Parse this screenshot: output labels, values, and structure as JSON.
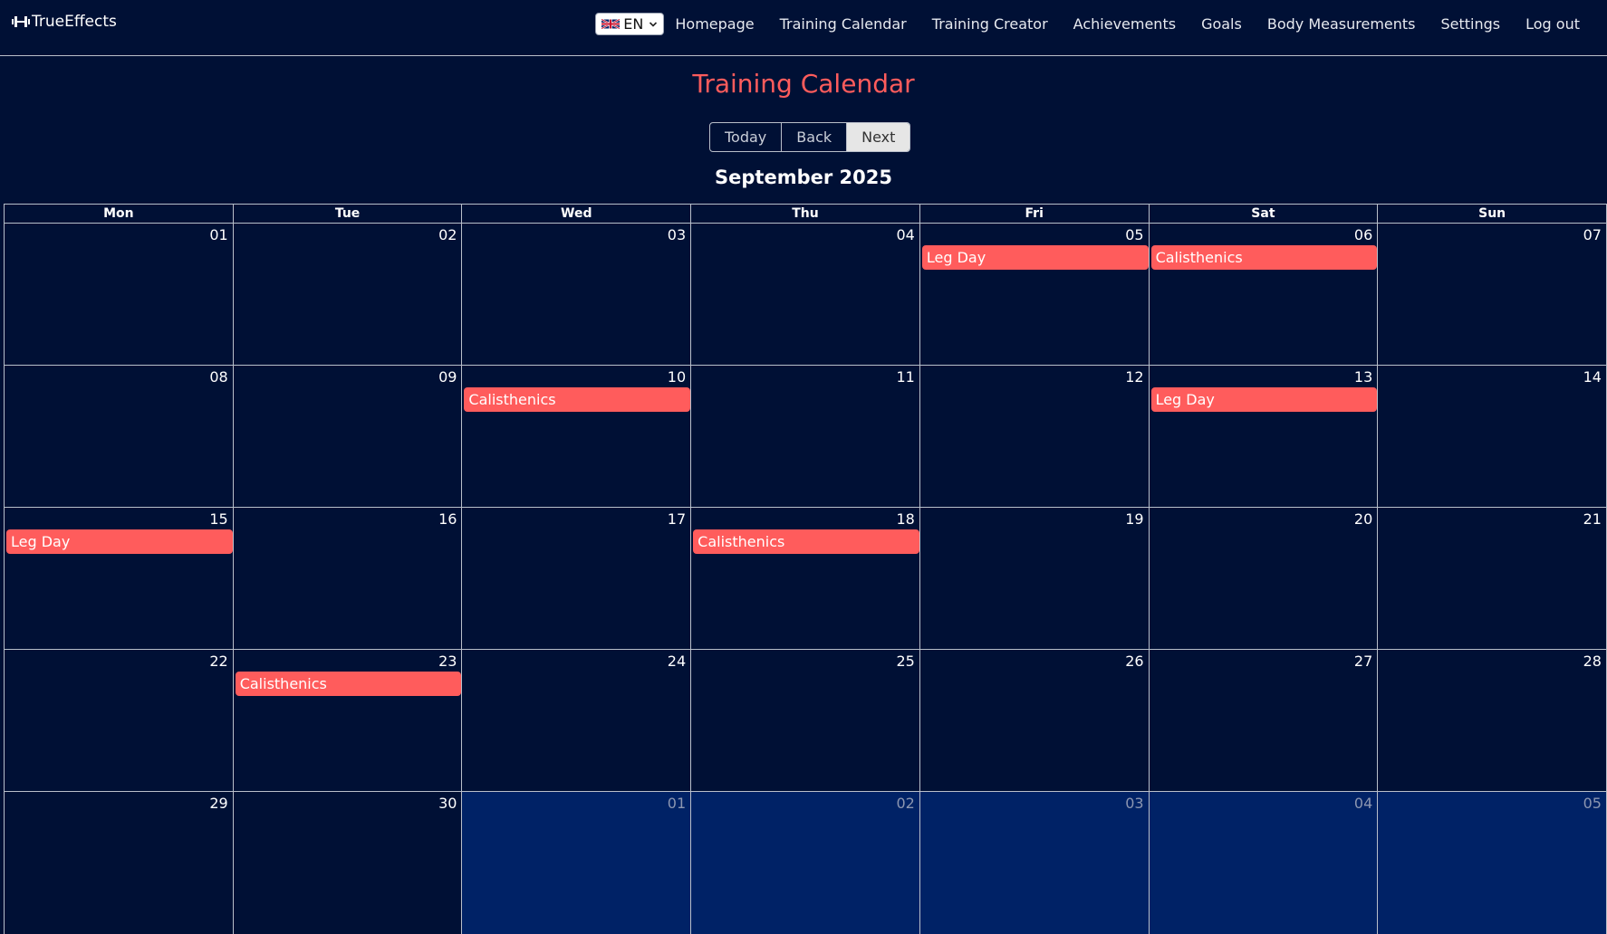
{
  "nav": {
    "brand": "TrueEffects",
    "language": "EN",
    "links": [
      {
        "label": "Homepage",
        "name": "nav-homepage"
      },
      {
        "label": "Training Calendar",
        "name": "nav-training-calendar"
      },
      {
        "label": "Training Creator",
        "name": "nav-training-creator"
      },
      {
        "label": "Achievements",
        "name": "nav-achievements"
      },
      {
        "label": "Goals",
        "name": "nav-goals"
      },
      {
        "label": "Body Measurements",
        "name": "nav-body-measurements"
      },
      {
        "label": "Settings",
        "name": "nav-settings"
      },
      {
        "label": "Log out",
        "name": "nav-log-out"
      }
    ]
  },
  "page": {
    "title": "Training Calendar",
    "month": "September 2025"
  },
  "toolbar": {
    "today": "Today",
    "back": "Back",
    "next": "Next"
  },
  "colors": {
    "background": "#001035",
    "accent": "#ff5c5c",
    "off_range": "#002266"
  },
  "calendar": {
    "weekdays": [
      "Mon",
      "Tue",
      "Wed",
      "Thu",
      "Fri",
      "Sat",
      "Sun"
    ],
    "weeks": [
      [
        {
          "day": "01",
          "off": false,
          "event": ""
        },
        {
          "day": "02",
          "off": false,
          "event": ""
        },
        {
          "day": "03",
          "off": false,
          "event": ""
        },
        {
          "day": "04",
          "off": false,
          "event": ""
        },
        {
          "day": "05",
          "off": false,
          "event": "Leg Day"
        },
        {
          "day": "06",
          "off": false,
          "event": "Calisthenics"
        },
        {
          "day": "07",
          "off": false,
          "event": ""
        }
      ],
      [
        {
          "day": "08",
          "off": false,
          "event": ""
        },
        {
          "day": "09",
          "off": false,
          "event": ""
        },
        {
          "day": "10",
          "off": false,
          "event": "Calisthenics"
        },
        {
          "day": "11",
          "off": false,
          "event": ""
        },
        {
          "day": "12",
          "off": false,
          "event": ""
        },
        {
          "day": "13",
          "off": false,
          "event": "Leg Day"
        },
        {
          "day": "14",
          "off": false,
          "event": ""
        }
      ],
      [
        {
          "day": "15",
          "off": false,
          "event": "Leg Day"
        },
        {
          "day": "16",
          "off": false,
          "event": ""
        },
        {
          "day": "17",
          "off": false,
          "event": ""
        },
        {
          "day": "18",
          "off": false,
          "event": "Calisthenics"
        },
        {
          "day": "19",
          "off": false,
          "event": ""
        },
        {
          "day": "20",
          "off": false,
          "event": ""
        },
        {
          "day": "21",
          "off": false,
          "event": ""
        }
      ],
      [
        {
          "day": "22",
          "off": false,
          "event": ""
        },
        {
          "day": "23",
          "off": false,
          "event": "Calisthenics"
        },
        {
          "day": "24",
          "off": false,
          "event": ""
        },
        {
          "day": "25",
          "off": false,
          "event": ""
        },
        {
          "day": "26",
          "off": false,
          "event": ""
        },
        {
          "day": "27",
          "off": false,
          "event": ""
        },
        {
          "day": "28",
          "off": false,
          "event": ""
        }
      ],
      [
        {
          "day": "29",
          "off": false,
          "event": ""
        },
        {
          "day": "30",
          "off": false,
          "event": ""
        },
        {
          "day": "01",
          "off": true,
          "event": ""
        },
        {
          "day": "02",
          "off": true,
          "event": ""
        },
        {
          "day": "03",
          "off": true,
          "event": ""
        },
        {
          "day": "04",
          "off": true,
          "event": ""
        },
        {
          "day": "05",
          "off": true,
          "event": ""
        }
      ]
    ]
  }
}
